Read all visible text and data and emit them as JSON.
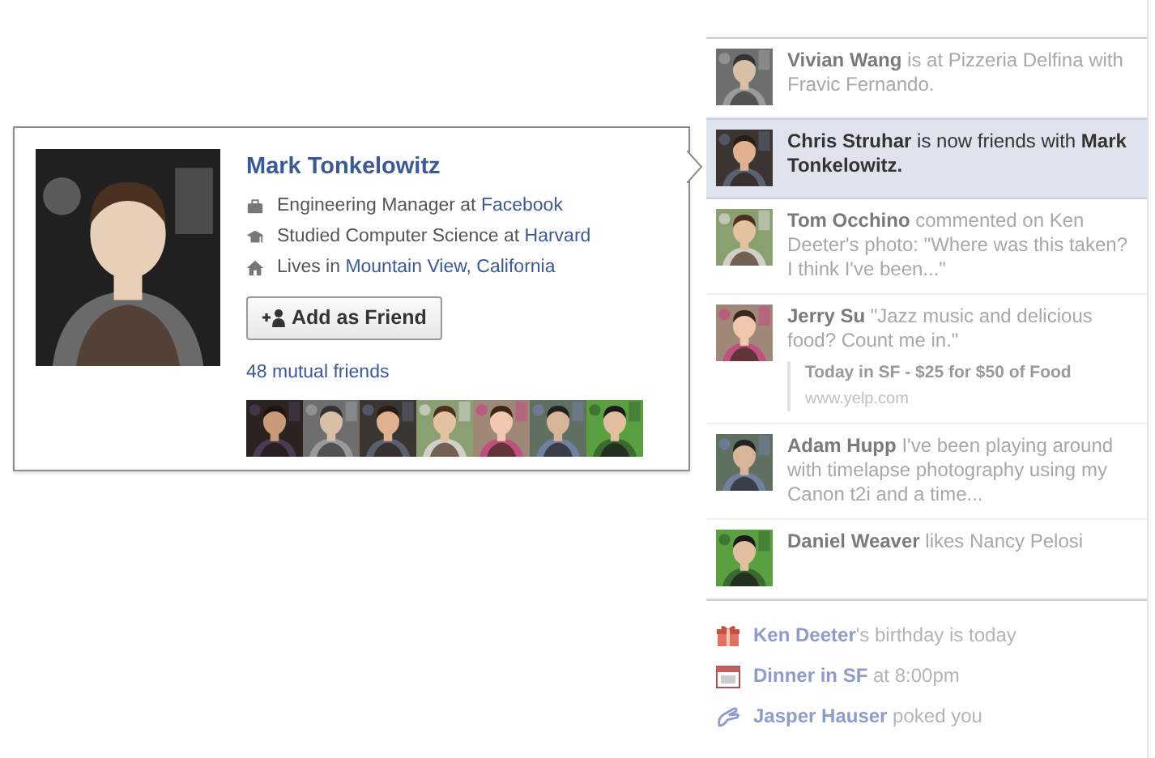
{
  "hovercard": {
    "name": "Mark Tonkelowitz",
    "details": [
      {
        "kind": "work",
        "prefix": "Engineering Manager at ",
        "link": "Facebook"
      },
      {
        "kind": "education",
        "prefix": "Studied Computer Science at ",
        "link": "Harvard"
      },
      {
        "kind": "home",
        "prefix": "Lives in ",
        "link": "Mountain View, California"
      }
    ],
    "button": "Add as Friend",
    "mutual_friends": "48 mutual friends"
  },
  "ticker": [
    {
      "actor": "Vivian Wang",
      "text": "is at Pizzeria Delfina with Fravic Fernando.",
      "selected": false
    },
    {
      "actor": "Chris Struhar",
      "text": "is now friends with **Mark Tonkelowitz.**",
      "selected": true
    },
    {
      "actor": "Tom Occhino",
      "text": "commented on Ken Deeter's photo: \"Where was this taken? I think I've been...\"",
      "selected": false
    },
    {
      "actor": "Jerry Su",
      "text": "\"Jazz music and delicious food? Count me in.\"",
      "selected": false,
      "attachment": {
        "title": "Today in SF - $25 for $50 of Food",
        "url": "www.yelp.com"
      }
    },
    {
      "actor": "Adam Hupp",
      "text": "I've been playing around with timelapse photography using my Canon t2i and a time...",
      "selected": false
    },
    {
      "actor": "Daniel Weaver",
      "text": "likes Nancy Pelosi",
      "selected": false
    }
  ],
  "reminders": [
    {
      "kind": "birthday",
      "link": "Ken Deeter",
      "text": "'s birthday is today"
    },
    {
      "kind": "event",
      "link": "Dinner in SF",
      "text": "at 8:00pm"
    },
    {
      "kind": "poke",
      "link": "Jasper Hauser",
      "text": "poked you"
    }
  ]
}
